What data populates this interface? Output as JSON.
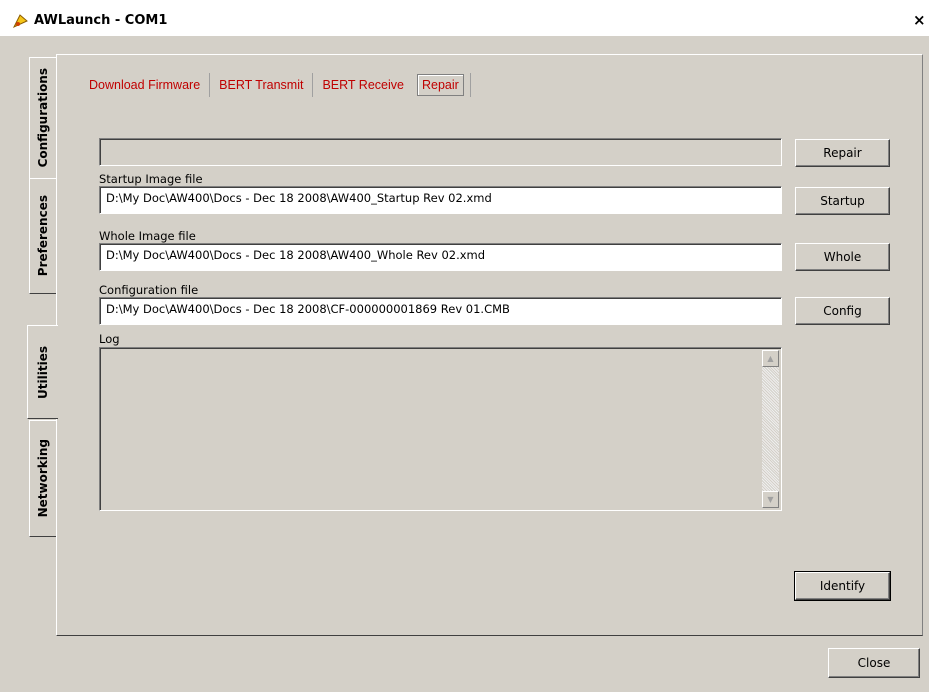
{
  "window": {
    "title": "AWLaunch - COM1",
    "close_glyph": "×"
  },
  "side_tabs": [
    {
      "label": "Configurations",
      "active": false
    },
    {
      "label": "Preferences",
      "active": false
    },
    {
      "label": "Utilities",
      "active": true
    },
    {
      "label": "Networking",
      "active": false
    }
  ],
  "top_tabs": [
    {
      "label": "Download Firmware",
      "active": false
    },
    {
      "label": "BERT Transmit",
      "active": false
    },
    {
      "label": "BERT Receive",
      "active": false
    },
    {
      "label": "Repair",
      "active": true
    }
  ],
  "repair_button": "Repair",
  "startup": {
    "label": "Startup Image file",
    "value": "D:\\My Doc\\AW400\\Docs - Dec 18 2008\\AW400_Startup Rev 02.xmd",
    "button": "Startup"
  },
  "whole": {
    "label": "Whole Image file",
    "value": "D:\\My Doc\\AW400\\Docs - Dec 18 2008\\AW400_Whole Rev 02.xmd",
    "button": "Whole"
  },
  "config": {
    "label": "Configuration file",
    "value": "D:\\My Doc\\AW400\\Docs - Dec 18 2008\\CF-000000001869 Rev 01.CMB",
    "button": "Config"
  },
  "log": {
    "label": "Log",
    "value": ""
  },
  "identify_button": "Identify",
  "close_button": "Close",
  "colors": {
    "tab_text": "#c00000",
    "face": "#d4d0c8"
  }
}
